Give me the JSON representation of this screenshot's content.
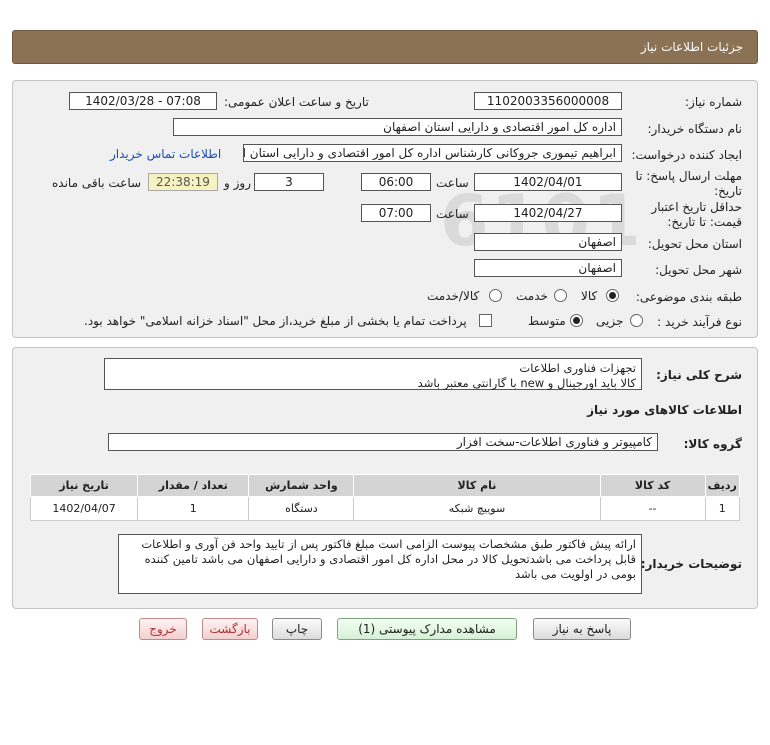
{
  "header": {
    "title": "جزئيات اطلاعات نياز"
  },
  "fields": {
    "need_number_label": "شماره نیاز:",
    "need_number": "1102003356000008",
    "announce_label": "تاریخ و ساعت اعلان عمومی:",
    "announce_value": "1402/03/28 - 07:08",
    "buyer_org_label": "نام دستگاه خریدار:",
    "buyer_org": "اداره کل امور اقتصادی و دارایی استان اصفهان",
    "creator_label": "ایجاد کننده درخواست:",
    "creator": "ابراهیم تیموری جروکانی کارشناس اداره کل امور اقتصادی و دارایی استان اصفهان",
    "contact_link": "اطلاعات تماس خریدار",
    "deadline_label_1": "مهلت ارسال پاسخ: تا",
    "deadline_label_2": "تاریخ:",
    "deadline_date": "1402/04/01",
    "time_label": "ساعت",
    "deadline_time": "06:00",
    "days_value": "3",
    "days_label": "روز و",
    "remaining_time": "22:38:19",
    "remaining_label": "ساعت باقی مانده",
    "validity_label_1": "حداقل تاریخ اعتبار",
    "validity_label_2": "قیمت: تا تاریخ:",
    "validity_date": "1402/04/27",
    "validity_time_label": "ساعت",
    "validity_time": "07:00",
    "province_label": "استان محل تحویل:",
    "province": "اصفهان",
    "city_label": "شهر محل تحویل:",
    "city": "اصفهان",
    "category_label": "طبقه بندی موضوعی:",
    "category_options": [
      "کالا",
      "خدمت",
      "کالا/خدمت"
    ],
    "process_label": "نوع فرآیند خرید :",
    "process_options": [
      "جزیی",
      "متوسط"
    ],
    "payment_note": "پرداخت تمام یا بخشی از مبلغ خرید،از محل \"اسناد خزانه اسلامی\" خواهد بود."
  },
  "summary": {
    "label": "شرح کلی نیاز:",
    "line1": "تجهزات فناوری اطلاعات",
    "line2": "کالا باید اورجینال و new با  گارانتی معتبر باشد"
  },
  "goods": {
    "section_title": "اطلاعات کالاهای مورد نیاز",
    "group_label": "گروه کالا:",
    "group_value": "کامپیوتر و فناوری اطلاعات-سخت افزار",
    "columns": [
      "ردیف",
      "کد کالا",
      "نام کالا",
      "واحد شمارش",
      "تعداد / مقدار",
      "تاریخ نیاز"
    ],
    "rows": [
      {
        "row": "1",
        "code": "--",
        "name": "سوییچ شبکه",
        "unit": "دستگاه",
        "qty": "1",
        "date": "1402/04/07"
      }
    ]
  },
  "buyer_notes": {
    "label": "توضیحات خریدار:",
    "line1": "ارائه پیش فاکتور طبق مشخصات پیوست الزامی است مبلغ فاکتور پس از تایید واحد فن آوری و اطلاعات",
    "line2": "قابل پرداخت می باشدتحویل کالا در محل اداره کل امور اقتصادی و دارایی اصفهان می باشد تامین کننده",
    "line3": "بومی در اولویت می باشد"
  },
  "buttons": {
    "reply": "پاسخ به نیاز",
    "attachments": "مشاهده مدارک پیوستی (1)",
    "print": "چاپ",
    "back": "بازگشت",
    "exit": "خروج"
  }
}
